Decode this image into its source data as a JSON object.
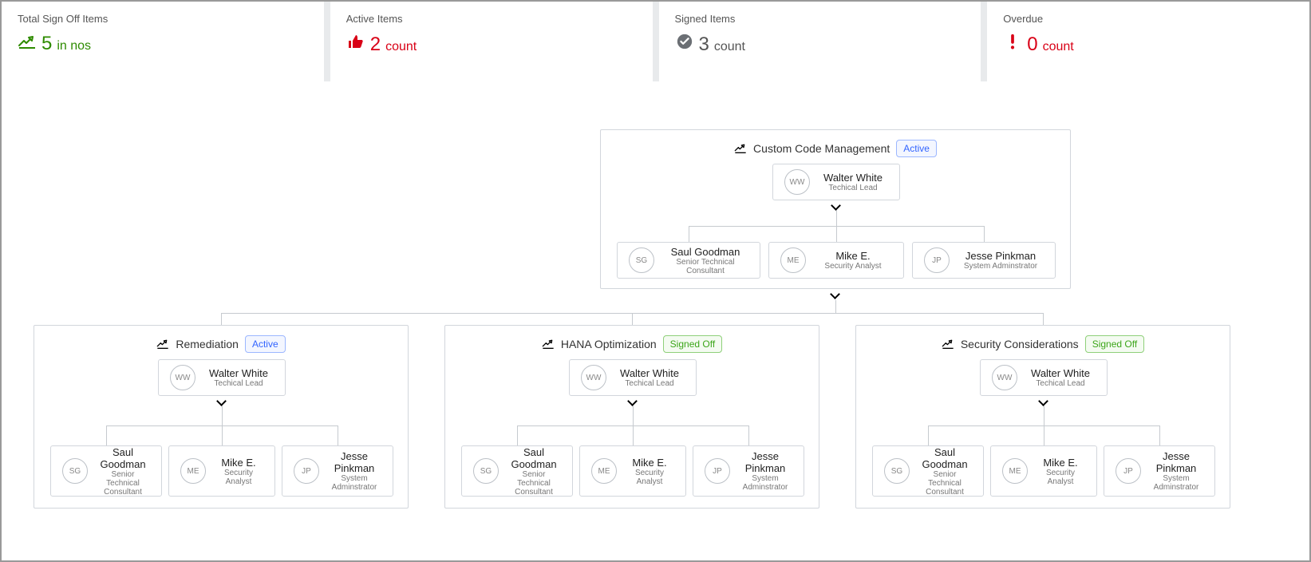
{
  "stats": [
    {
      "title": "Total Sign Off Items",
      "icon": "signature-icon",
      "number": "5",
      "unit": "in nos",
      "colorClass": "c-green"
    },
    {
      "title": "Active Items",
      "icon": "thumbs-up-icon",
      "number": "2",
      "unit": "count",
      "colorClass": "c-red"
    },
    {
      "title": "Signed Items",
      "icon": "check-circle-icon",
      "number": "3",
      "unit": "count",
      "colorClass": "c-gray"
    },
    {
      "title": "Overdue",
      "icon": "exclaim-icon",
      "number": "0",
      "unit": "count",
      "colorClass": "c-red"
    }
  ],
  "status": {
    "active": "Active",
    "signedOff": "Signed Off"
  },
  "groups": {
    "root": {
      "title": "Custom Code Management",
      "statusKey": "active",
      "lead": {
        "initials": "WW",
        "name": "Walter White",
        "role": "Techical Lead"
      },
      "members": [
        {
          "initials": "SG",
          "name": "Saul Goodman",
          "role": "Senior Technical Consultant"
        },
        {
          "initials": "ME",
          "name": "Mike E.",
          "role": "Security Analyst"
        },
        {
          "initials": "JP",
          "name": "Jesse Pinkman",
          "role": "System Adminstrator"
        }
      ]
    },
    "remediation": {
      "title": "Remediation",
      "statusKey": "active",
      "lead": {
        "initials": "WW",
        "name": "Walter White",
        "role": "Techical Lead"
      },
      "members": [
        {
          "initials": "SG",
          "name": "Saul Goodman",
          "role": "Senior Technical Consultant"
        },
        {
          "initials": "ME",
          "name": "Mike E.",
          "role": "Security Analyst"
        },
        {
          "initials": "JP",
          "name": "Jesse Pinkman",
          "role": "System Adminstrator"
        }
      ]
    },
    "hana": {
      "title": "HANA Optimization",
      "statusKey": "signedOff",
      "lead": {
        "initials": "WW",
        "name": "Walter White",
        "role": "Techical Lead"
      },
      "members": [
        {
          "initials": "SG",
          "name": "Saul Goodman",
          "role": "Senior Technical Consultant"
        },
        {
          "initials": "ME",
          "name": "Mike E.",
          "role": "Security Analyst"
        },
        {
          "initials": "JP",
          "name": "Jesse Pinkman",
          "role": "System Adminstrator"
        }
      ]
    },
    "security": {
      "title": "Security Considerations",
      "statusKey": "signedOff",
      "lead": {
        "initials": "WW",
        "name": "Walter White",
        "role": "Techical Lead"
      },
      "members": [
        {
          "initials": "SG",
          "name": "Saul Goodman",
          "role": "Senior Technical Consultant"
        },
        {
          "initials": "ME",
          "name": "Mike E.",
          "role": "Security Analyst"
        },
        {
          "initials": "JP",
          "name": "Jesse Pinkman",
          "role": "System Adminstrator"
        }
      ]
    }
  },
  "chart_data": {
    "type": "tree",
    "title": "Sign-off hierarchy",
    "root": {
      "name": "Custom Code Management",
      "status": "Active",
      "team": {
        "lead": {
          "name": "Walter White",
          "role": "Techical Lead"
        },
        "members": [
          {
            "name": "Saul Goodman",
            "role": "Senior Technical Consultant"
          },
          {
            "name": "Mike E.",
            "role": "Security Analyst"
          },
          {
            "name": "Jesse Pinkman",
            "role": "System Adminstrator"
          }
        ]
      },
      "children": [
        {
          "name": "Remediation",
          "status": "Active",
          "team": {
            "lead": {
              "name": "Walter White",
              "role": "Techical Lead"
            },
            "members": [
              {
                "name": "Saul Goodman",
                "role": "Senior Technical Consultant"
              },
              {
                "name": "Mike E.",
                "role": "Security Analyst"
              },
              {
                "name": "Jesse Pinkman",
                "role": "System Adminstrator"
              }
            ]
          }
        },
        {
          "name": "HANA Optimization",
          "status": "Signed Off",
          "team": {
            "lead": {
              "name": "Walter White",
              "role": "Techical Lead"
            },
            "members": [
              {
                "name": "Saul Goodman",
                "role": "Senior Technical Consultant"
              },
              {
                "name": "Mike E.",
                "role": "Security Analyst"
              },
              {
                "name": "Jesse Pinkman",
                "role": "System Adminstrator"
              }
            ]
          }
        },
        {
          "name": "Security Considerations",
          "status": "Signed Off",
          "team": {
            "lead": {
              "name": "Walter White",
              "role": "Techical Lead"
            },
            "members": [
              {
                "name": "Saul Goodman",
                "role": "Senior Technical Consultant"
              },
              {
                "name": "Mike E.",
                "role": "Security Analyst"
              },
              {
                "name": "Jesse Pinkman",
                "role": "System Adminstrator"
              }
            ]
          }
        }
      ]
    }
  }
}
